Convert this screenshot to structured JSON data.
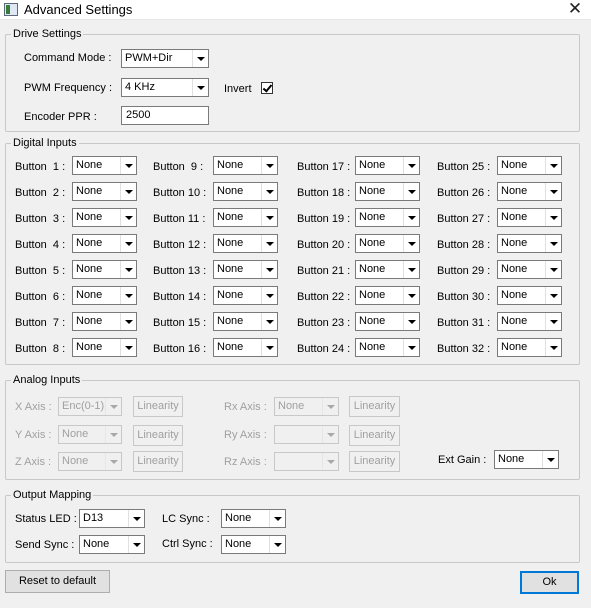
{
  "window": {
    "title": "Advanced Settings",
    "close_glyph": "✕"
  },
  "drive": {
    "title": "Drive Settings",
    "command_mode_label": "Command Mode :",
    "command_mode_value": "PWM+Dir",
    "pwm_freq_label": "PWM Frequency :",
    "pwm_freq_value": "4 KHz",
    "invert_label": "Invert",
    "invert_checked": true,
    "encoder_label": "Encoder PPR :",
    "encoder_value": "2500"
  },
  "digital": {
    "title": "Digital Inputs",
    "buttons": [
      {
        "label": "Button  1 :",
        "value": "None"
      },
      {
        "label": "Button  2 :",
        "value": "None"
      },
      {
        "label": "Button  3 :",
        "value": "None"
      },
      {
        "label": "Button  4 :",
        "value": "None"
      },
      {
        "label": "Button  5 :",
        "value": "None"
      },
      {
        "label": "Button  6 :",
        "value": "None"
      },
      {
        "label": "Button  7 :",
        "value": "None"
      },
      {
        "label": "Button  8 :",
        "value": "None"
      },
      {
        "label": "Button  9 :",
        "value": "None"
      },
      {
        "label": "Button 10 :",
        "value": "None"
      },
      {
        "label": "Button 11 :",
        "value": "None"
      },
      {
        "label": "Button 12 :",
        "value": "None"
      },
      {
        "label": "Button 13 :",
        "value": "None"
      },
      {
        "label": "Button 14 :",
        "value": "None"
      },
      {
        "label": "Button 15 :",
        "value": "None"
      },
      {
        "label": "Button 16 :",
        "value": "None"
      },
      {
        "label": "Button 17 :",
        "value": "None"
      },
      {
        "label": "Button 18 :",
        "value": "None"
      },
      {
        "label": "Button 19 :",
        "value": "None"
      },
      {
        "label": "Button 20 :",
        "value": "None"
      },
      {
        "label": "Button 21 :",
        "value": "None"
      },
      {
        "label": "Button 22 :",
        "value": "None"
      },
      {
        "label": "Button 23 :",
        "value": "None"
      },
      {
        "label": "Button 24 :",
        "value": "None"
      },
      {
        "label": "Button 25 :",
        "value": "None"
      },
      {
        "label": "Button 26 :",
        "value": "None"
      },
      {
        "label": "Button 27 :",
        "value": "None"
      },
      {
        "label": "Button 28 :",
        "value": "None"
      },
      {
        "label": "Button 29 :",
        "value": "None"
      },
      {
        "label": "Button 30 :",
        "value": "None"
      },
      {
        "label": "Button 31 :",
        "value": "None"
      },
      {
        "label": "Button 32 :",
        "value": "None"
      }
    ]
  },
  "analog": {
    "title": "Analog Inputs",
    "x_label": "X Axis :",
    "x_value": "Enc(0-1)",
    "y_label": "Y Axis :",
    "y_value": "None",
    "z_label": "Z Axis :",
    "z_value": "None",
    "rx_label": "Rx Axis :",
    "rx_value": "None",
    "ry_label": "Ry Axis :",
    "ry_value": "",
    "rz_label": "Rz Axis :",
    "rz_value": "",
    "linearity_label": "Linearity",
    "ext_gain_label": "Ext Gain :",
    "ext_gain_value": "None"
  },
  "output": {
    "title": "Output Mapping",
    "status_led_label": "Status LED :",
    "status_led_value": "D13",
    "send_sync_label": "Send Sync :",
    "send_sync_value": "None",
    "lc_sync_label": "LC Sync :",
    "lc_sync_value": "None",
    "ctrl_sync_label": "Ctrl Sync :",
    "ctrl_sync_value": "None"
  },
  "footer": {
    "reset_label": "Reset to default",
    "ok_label": "Ok"
  }
}
